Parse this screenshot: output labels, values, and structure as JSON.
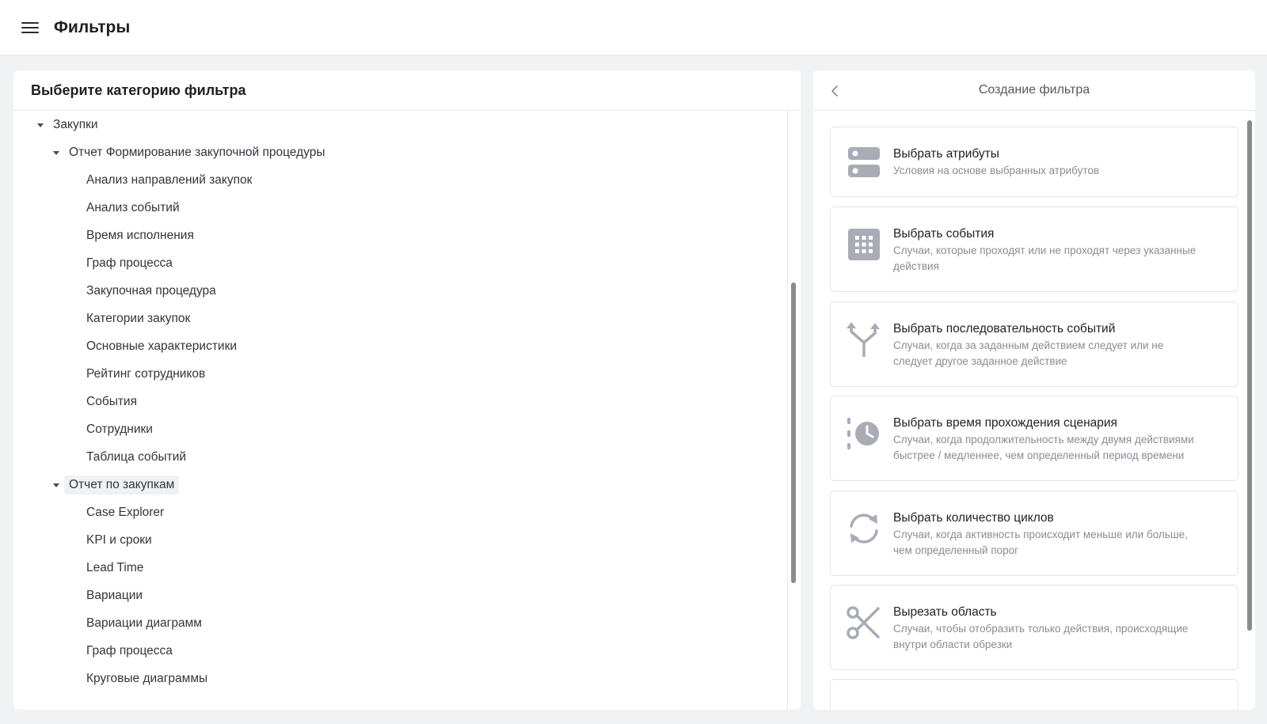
{
  "header": {
    "title": "Фильтры",
    "menu_icon": "hamburger-icon"
  },
  "left_panel": {
    "title": "Выберите категорию фильтра",
    "tree": [
      {
        "label": "Закупки",
        "level": 0,
        "expanded": true
      },
      {
        "label": "Отчет Формирование закупочной процедуры",
        "level": 1,
        "expanded": true
      },
      {
        "label": "Анализ направлений закупок",
        "level": 2
      },
      {
        "label": "Анализ событий",
        "level": 2
      },
      {
        "label": "Время исполнения",
        "level": 2
      },
      {
        "label": "Граф процесса",
        "level": 2
      },
      {
        "label": "Закупочная процедура",
        "level": 2
      },
      {
        "label": "Категории закупок",
        "level": 2
      },
      {
        "label": "Основные характеристики",
        "level": 2
      },
      {
        "label": "Рейтинг сотрудников",
        "level": 2
      },
      {
        "label": "События",
        "level": 2
      },
      {
        "label": "Сотрудники",
        "level": 2
      },
      {
        "label": "Таблица событий",
        "level": 2
      },
      {
        "label": "Отчет по закупкам",
        "level": 1,
        "expanded": true,
        "highlighted": true
      },
      {
        "label": "Case Explorer",
        "level": 2
      },
      {
        "label": "KPI и сроки",
        "level": 2
      },
      {
        "label": "Lead Time",
        "level": 2
      },
      {
        "label": "Вариации",
        "level": 2
      },
      {
        "label": "Вариации диаграмм",
        "level": 2
      },
      {
        "label": "Граф процесса",
        "level": 2
      },
      {
        "label": "Круговые диаграммы",
        "level": 2
      }
    ]
  },
  "right_panel": {
    "title": "Создание фильтра",
    "back_icon": "chevron-left-icon",
    "cards": [
      {
        "icon": "attributes-icon",
        "title": "Выбрать атрибуты",
        "desc": [
          "Условия на основе выбранных атрибутов"
        ]
      },
      {
        "icon": "grid-icon",
        "title": "Выбрать события",
        "desc": [
          "Случаи, которые проходят или не проходят через указанные",
          "действия"
        ]
      },
      {
        "icon": "fork-icon",
        "title": "Выбрать последовательность событий",
        "desc": [
          "Случаи, когда за заданным действием следует или не",
          "следует другое заданное действие"
        ]
      },
      {
        "icon": "clock-icon",
        "title": "Выбрать время прохождения сценария",
        "desc": [
          "Случаи, когда продолжительность между двумя действиями",
          "быстрее / медленнее, чем определенный период времени"
        ]
      },
      {
        "icon": "refresh-icon",
        "title": "Выбрать количество циклов",
        "desc": [
          "Случаи, когда активность происходит меньше или больше,",
          "чем определенный порог"
        ]
      },
      {
        "icon": "scissors-icon",
        "title": "Вырезать область",
        "desc": [
          "Случаи, чтобы отобразить только действия, происходящие",
          "внутри области обрезки"
        ]
      }
    ]
  },
  "colors": {
    "icon_gray": "#a9abb5",
    "text_main": "#1f2024",
    "text_muted": "#8a8c93",
    "background": "#f1f2f4"
  }
}
